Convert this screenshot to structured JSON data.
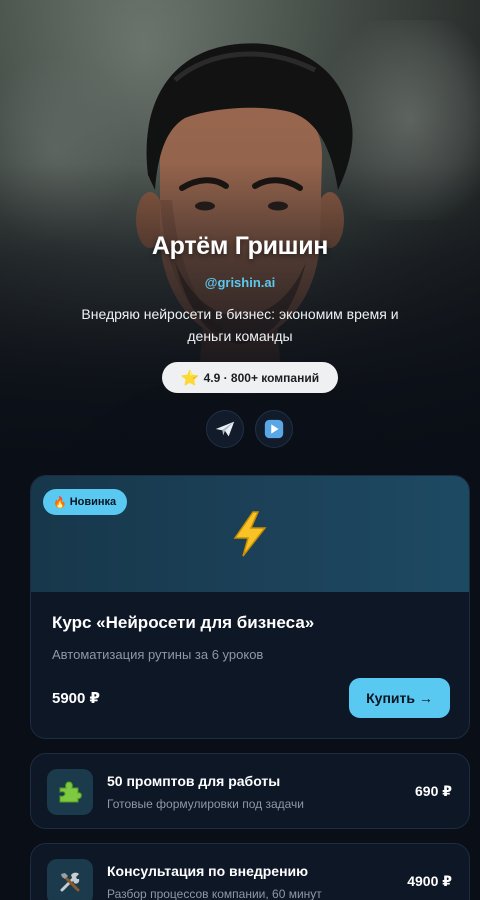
{
  "profile": {
    "name": "Артём Гришин",
    "handle": "@grishin.ai",
    "bio": "Внедряю нейросети в бизнес: экономим время и деньги команды",
    "rating_icon": "star-icon",
    "rating_text": "4.9 · 800+ компаний",
    "socials": [
      {
        "icon": "telegram-plane-icon"
      },
      {
        "icon": "play-button-icon"
      }
    ]
  },
  "featured": {
    "badge_icon": "fire-icon",
    "badge": "Новинка",
    "cover_icon": "lightning-bolt-icon",
    "title": "Курс «Нейросети для бизнеса»",
    "subtitle": "Автоматизация рутины за 6 уроков",
    "price": "5900 ₽",
    "button": "Купить →"
  },
  "products": [
    {
      "icon": "puzzle-piece-icon",
      "title": "50 промптов для работы",
      "subtitle": "Готовые формулировки под задачи",
      "price": "690 ₽"
    },
    {
      "icon": "tools-icon",
      "title": "Консультация по внедрению",
      "subtitle": "Разбор процессов компании, 60 минут",
      "price": "4900 ₽"
    }
  ],
  "colors": {
    "accent": "#59c9f2",
    "background": "#0a0e16",
    "card": "#0d1726",
    "muted_text": "#8c98a8"
  }
}
